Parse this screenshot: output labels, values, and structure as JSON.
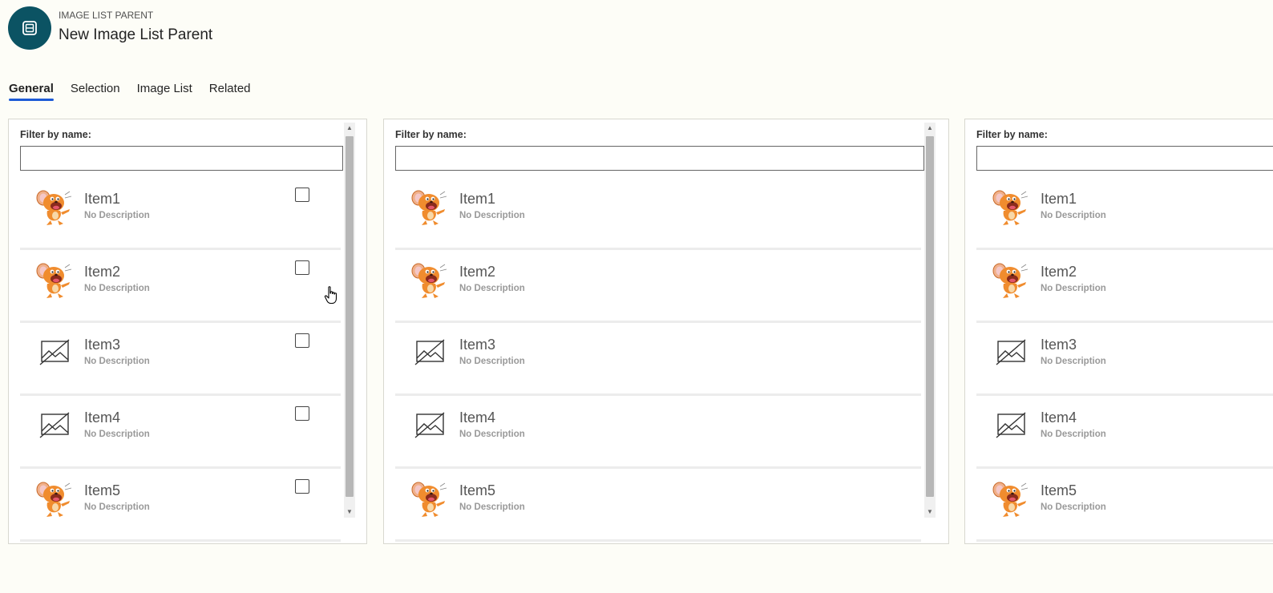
{
  "header": {
    "entity_type": "IMAGE LIST PARENT",
    "title": "New Image List Parent"
  },
  "tabs": [
    {
      "label": "General",
      "active": true
    },
    {
      "label": "Selection",
      "active": false
    },
    {
      "label": "Image List",
      "active": false
    },
    {
      "label": "Related",
      "active": false
    }
  ],
  "panels": [
    {
      "filter_label": "Filter by name:",
      "filter_value": "",
      "has_checkboxes": true,
      "items": [
        {
          "title": "Item1",
          "description": "No Description",
          "image": "cartoon-mouse",
          "checked": false
        },
        {
          "title": "Item2",
          "description": "No Description",
          "image": "cartoon-mouse",
          "checked": false
        },
        {
          "title": "Item3",
          "description": "No Description",
          "image": "broken-image-icon",
          "checked": false
        },
        {
          "title": "Item4",
          "description": "No Description",
          "image": "broken-image-icon",
          "checked": false
        },
        {
          "title": "Item5",
          "description": "No Description",
          "image": "cartoon-mouse",
          "checked": false
        }
      ]
    },
    {
      "filter_label": "Filter by name:",
      "filter_value": "",
      "has_checkboxes": false,
      "items": [
        {
          "title": "Item1",
          "description": "No Description",
          "image": "cartoon-mouse"
        },
        {
          "title": "Item2",
          "description": "No Description",
          "image": "cartoon-mouse"
        },
        {
          "title": "Item3",
          "description": "No Description",
          "image": "broken-image-icon"
        },
        {
          "title": "Item4",
          "description": "No Description",
          "image": "broken-image-icon"
        },
        {
          "title": "Item5",
          "description": "No Description",
          "image": "cartoon-mouse"
        }
      ]
    },
    {
      "filter_label": "Filter by name:",
      "filter_value": "",
      "has_checkboxes": false,
      "items": [
        {
          "title": "Item1",
          "description": "No Description",
          "image": "cartoon-mouse"
        },
        {
          "title": "Item2",
          "description": "No Description",
          "image": "cartoon-mouse"
        },
        {
          "title": "Item3",
          "description": "No Description",
          "image": "broken-image-icon"
        },
        {
          "title": "Item4",
          "description": "No Description",
          "image": "broken-image-icon"
        },
        {
          "title": "Item5",
          "description": "No Description",
          "image": "cartoon-mouse"
        }
      ]
    }
  ],
  "colors": {
    "accent": "#1d5bd6",
    "entity_icon_bg": "#0b5363",
    "page_bg": "#fdfdf7"
  },
  "icons": {
    "entity": "table-icon",
    "cursor": "hand-pointer-cursor"
  }
}
